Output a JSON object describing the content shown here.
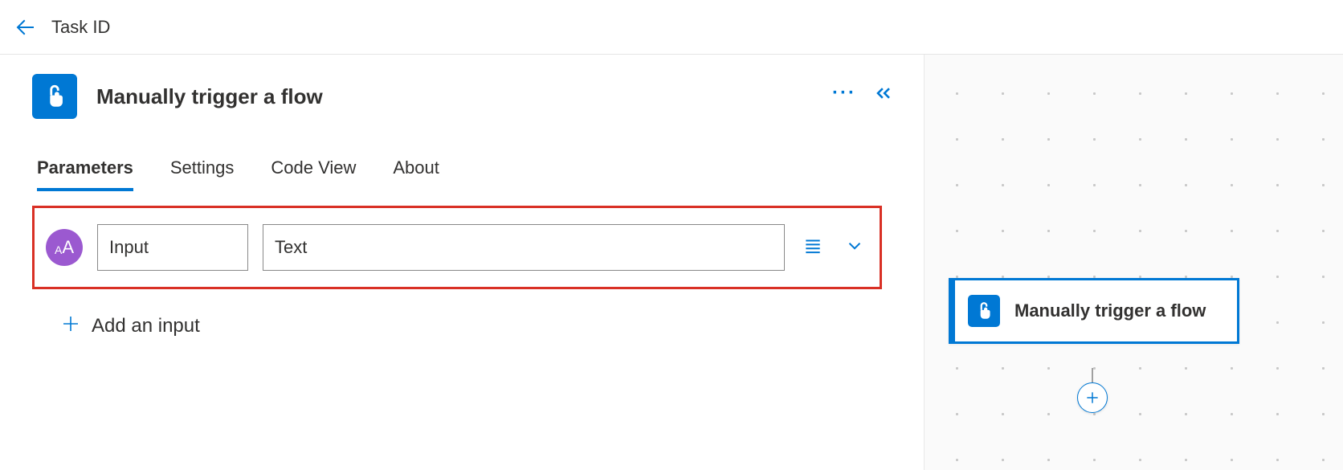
{
  "header": {
    "title": "Task ID"
  },
  "trigger": {
    "title": "Manually trigger a flow"
  },
  "tabs": [
    {
      "label": "Parameters",
      "active": true
    },
    {
      "label": "Settings",
      "active": false
    },
    {
      "label": "Code View",
      "active": false
    },
    {
      "label": "About",
      "active": false
    }
  ],
  "inputRow": {
    "typeBadge": "AA",
    "name": "Input",
    "value": "Text"
  },
  "addInput": {
    "label": "Add an input"
  },
  "canvas": {
    "nodeTitle": "Manually trigger a flow"
  }
}
